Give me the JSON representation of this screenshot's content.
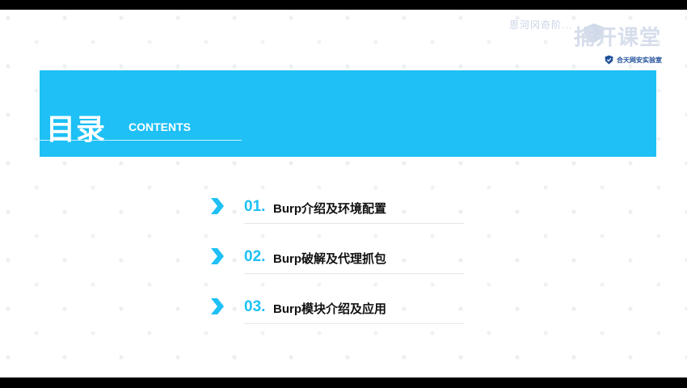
{
  "logo": {
    "faded_text": "恩河冈奇阶...",
    "big_text": "捕开课堂",
    "brand_name": "合天网安实验室"
  },
  "banner": {
    "title": "目录",
    "subtitle": "CONTENTS"
  },
  "items": [
    {
      "number": "01.",
      "label": "Burp介绍及环境配置"
    },
    {
      "number": "02.",
      "label": "Burp破解及代理抓包"
    },
    {
      "number": "03.",
      "label": "Burp模块介绍及应用"
    }
  ],
  "colors": {
    "accent": "#1ec0f6",
    "text": "#111111",
    "brand": "#1f4f9a"
  }
}
